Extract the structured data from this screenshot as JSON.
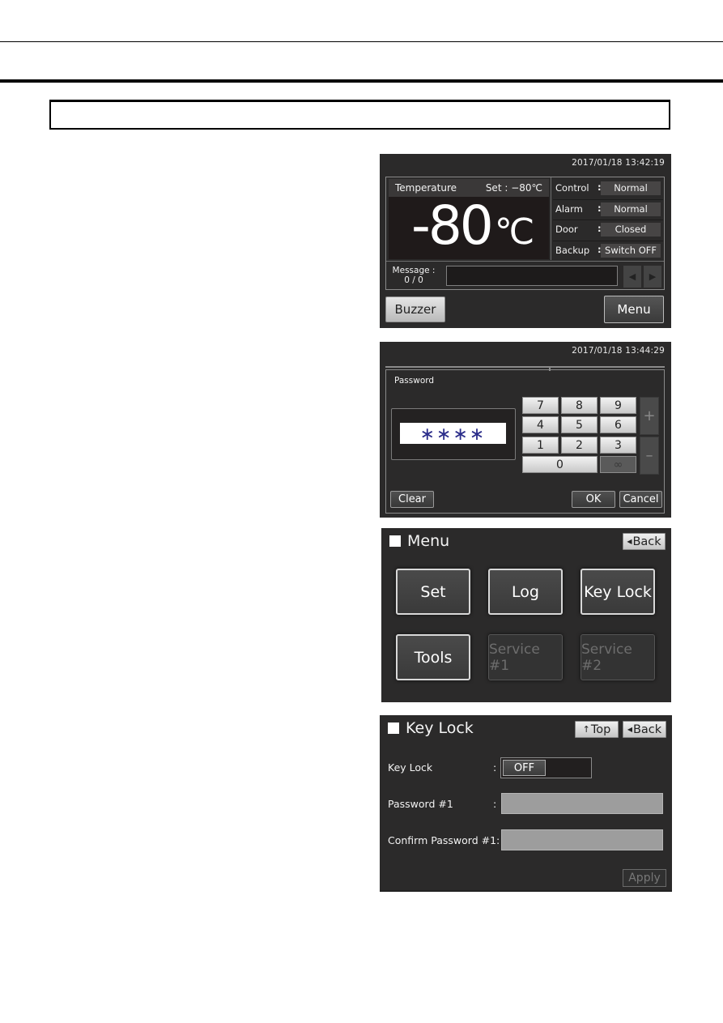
{
  "page": {
    "title_box_text": ""
  },
  "home_screen": {
    "datetime": "2017/01/18  13:42:19",
    "temperature_label": "Temperature",
    "set_label": "Set :  −80℃",
    "current_temp_value": "-80",
    "current_temp_unit": "℃",
    "status": [
      {
        "key": "Control",
        "value": "Normal"
      },
      {
        "key": "Alarm",
        "value": "Normal"
      },
      {
        "key": "Door",
        "value": "Closed"
      },
      {
        "key": "Backup",
        "value": "Switch OFF"
      }
    ],
    "message_label": "Message :",
    "message_count": "0 / 0",
    "message_text": "",
    "prev_icon": "triangle-left-icon",
    "next_icon": "triangle-right-icon",
    "buzzer_label": "Buzzer",
    "menu_label": "Menu"
  },
  "password_screen": {
    "datetime": "2017/01/18  13:44:29",
    "title": "Password",
    "masked_value": "∗∗∗∗",
    "keys": [
      "7",
      "8",
      "9",
      "4",
      "5",
      "6",
      "1",
      "2",
      "3",
      "0",
      "∞"
    ],
    "plus_label": "+",
    "minus_label": "–",
    "clear_label": "Clear",
    "ok_label": "OK",
    "cancel_label": "Cancel"
  },
  "menu_screen": {
    "title": "Menu",
    "back_label": "Back",
    "tiles": [
      {
        "label": "Set",
        "enabled": true
      },
      {
        "label": "Log",
        "enabled": true
      },
      {
        "label": "Key Lock",
        "enabled": true
      },
      {
        "label": "Tools",
        "enabled": true
      },
      {
        "label": "Service #1",
        "enabled": false
      },
      {
        "label": "Service #2",
        "enabled": false
      }
    ]
  },
  "keylock_screen": {
    "title": "Key Lock",
    "top_label": "Top",
    "back_label": "Back",
    "keylock_label": "Key Lock",
    "keylock_state": "OFF",
    "password_label": "Password  #1",
    "confirm_label": "Confirm Password  #1:",
    "colon": ":",
    "password_value": "",
    "confirm_value": "",
    "apply_label": "Apply"
  }
}
